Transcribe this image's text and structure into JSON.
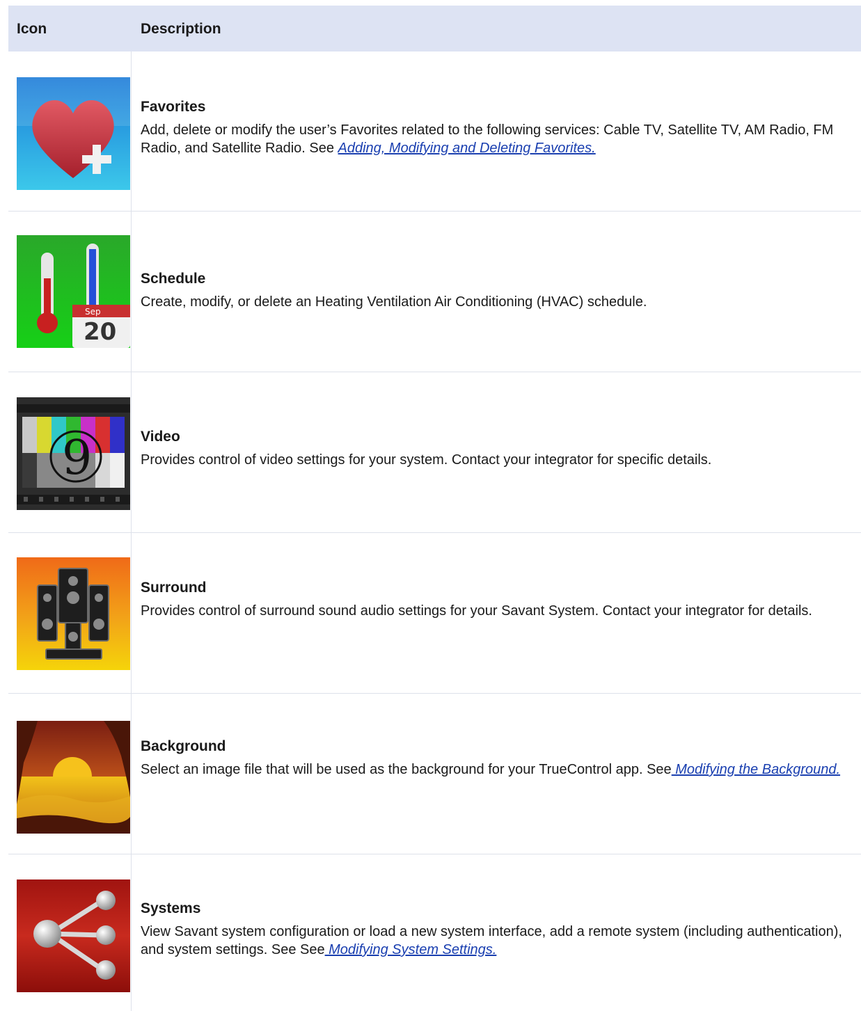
{
  "header": {
    "icon_col": "Icon",
    "desc_col": "Description"
  },
  "rows": [
    {
      "title": "Favorites",
      "text": "Add, delete or modify the user’s Favorites related to the following services: Cable TV, Satellite TV, AM Radio, FM Radio, and Satellite Radio. See ",
      "link": "Adding, Modifying and Deleting Favorites.",
      "icon": "heart-plus-icon"
    },
    {
      "title": "Schedule",
      "text": "Create, modify, or delete an Heating Ventilation Air Conditioning (HVAC) schedule.",
      "icon": "thermometer-calendar-icon",
      "icon_month": "Sep",
      "icon_day": "20"
    },
    {
      "title": "Video",
      "text": "Provides control of video settings for your system. Contact your integrator for specific details.",
      "icon": "film-countdown-icon",
      "icon_digit": "9"
    },
    {
      "title": "Surround",
      "text": "Provides control of surround sound audio settings for your Savant System. Contact your integrator for details.",
      "icon": "speakers-icon"
    },
    {
      "title": "Background",
      "text": "Select an image file that will be used as the background for your TrueControl app. See",
      "link": " Modifying the Background.",
      "icon": "sunset-icon"
    },
    {
      "title": "Systems",
      "text": "View Savant system configuration or load a new system interface, add a remote system (including authentication), and system settings. See See",
      "link": " Modifying System Settings.",
      "icon": "share-network-icon"
    }
  ],
  "colors": {
    "header_bg": "#dde3f3",
    "link": "#1a3fb0",
    "row_border": "#dde1ea"
  }
}
